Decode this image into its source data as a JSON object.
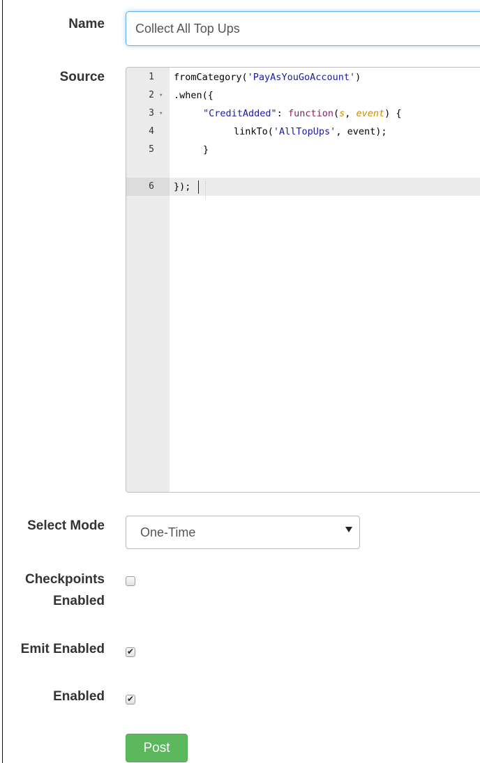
{
  "form": {
    "name_label": "Name",
    "name_value": "Collect All Top Ups",
    "source_label": "Source",
    "select_mode_label": "Select Mode",
    "select_mode_value": "One-Time",
    "checkpoints_label_line1": "Checkpoints",
    "checkpoints_label_line2": "Enabled",
    "checkpoints_checked": false,
    "emit_label": "Emit Enabled",
    "emit_checked": true,
    "enabled_label": "Enabled",
    "enabled_checked": true,
    "post_label": "Post"
  },
  "editor": {
    "active_line": 6,
    "lines": [
      {
        "num": "1",
        "fold": ""
      },
      {
        "num": "2",
        "fold": "▾"
      },
      {
        "num": "3",
        "fold": "▾"
      },
      {
        "num": "4",
        "fold": ""
      },
      {
        "num": "5",
        "fold": ""
      },
      {
        "num": "6",
        "fold": ""
      }
    ],
    "code": {
      "l1_fn": "fromCategory(",
      "l1_str": "'PayAsYouGoAccount'",
      "l1_end": ")",
      "l2": ".when({",
      "l3_key": "\"CreditAdded\"",
      "l3_colon": ": ",
      "l3_kw": "function",
      "l3_open": "(",
      "l3_p1": "s",
      "l3_comma": ", ",
      "l3_p2": "event",
      "l3_close": ") {",
      "l4_fn": "linkTo(",
      "l4_str": "'AllTopUps'",
      "l4_end": ", event);",
      "l5": "}",
      "l6": "});"
    }
  },
  "colors": {
    "post_button": "#5cb85c",
    "focus_border": "#66afe9",
    "string_token": "#1a1aa6",
    "keyword_token": "#931a68",
    "param_token": "#d18b00"
  }
}
